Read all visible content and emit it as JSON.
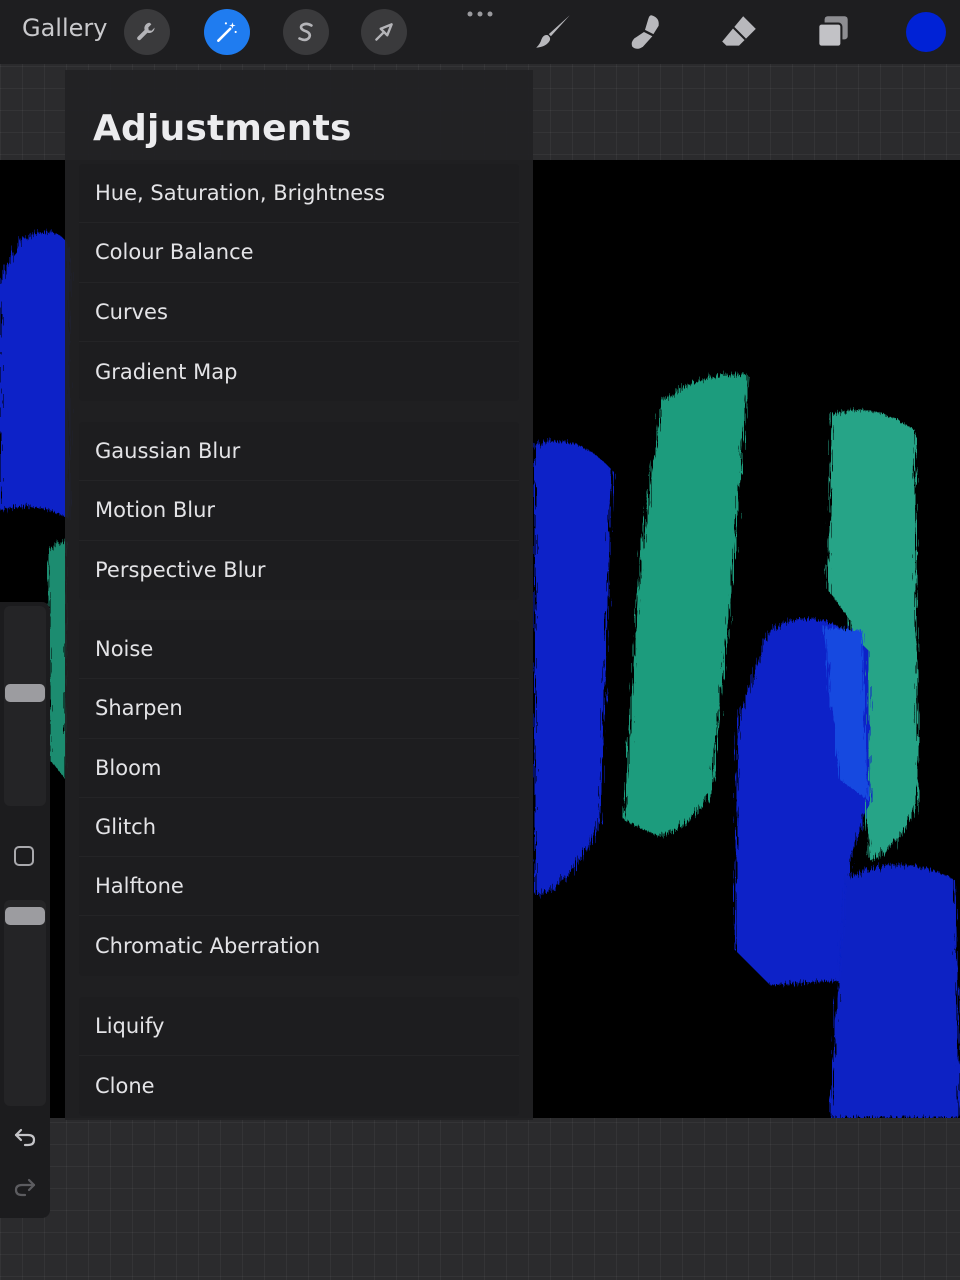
{
  "toolbar": {
    "gallery_label": "Gallery",
    "tools_left": [
      {
        "name": "actions",
        "icon": "wrench-icon",
        "active": false
      },
      {
        "name": "adjustments",
        "icon": "magic-wand-icon",
        "active": true
      },
      {
        "name": "selection",
        "icon": "selection-s-icon",
        "active": false
      },
      {
        "name": "transform",
        "icon": "arrow-cursor-icon",
        "active": false
      }
    ],
    "tools_right": [
      {
        "name": "brush",
        "icon": "brush-icon"
      },
      {
        "name": "smudge",
        "icon": "smudge-icon"
      },
      {
        "name": "eraser",
        "icon": "eraser-icon"
      },
      {
        "name": "layers",
        "icon": "layers-icon"
      }
    ],
    "current_color": "#0022d6"
  },
  "adjustments": {
    "title": "Adjustments",
    "groups": [
      [
        "Hue, Saturation, Brightness",
        "Colour Balance",
        "Curves",
        "Gradient Map"
      ],
      [
        "Gaussian Blur",
        "Motion Blur",
        "Perspective Blur"
      ],
      [
        "Noise",
        "Sharpen",
        "Bloom",
        "Glitch",
        "Halftone",
        "Chromatic Aberration"
      ],
      [
        "Liquify",
        "Clone"
      ]
    ]
  },
  "colors": {
    "accent": "#1f7cf0",
    "stroke_green": "#1f9c7d",
    "stroke_blue": "#0b22c8"
  }
}
